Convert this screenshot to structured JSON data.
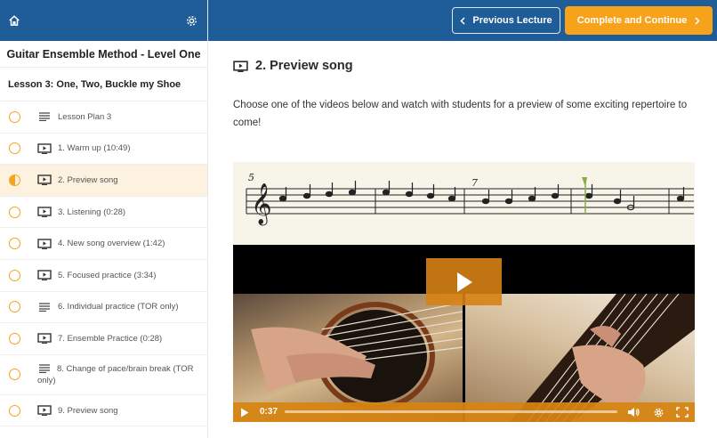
{
  "sidebar": {
    "course_title": "Guitar Ensemble Method - Level One",
    "lesson_title": "Lesson 3: One, Two, Buckle my Shoe",
    "items": [
      {
        "label": "Lesson Plan 3",
        "type": "text",
        "status": "empty"
      },
      {
        "label": "1. Warm up (10:49)",
        "type": "video",
        "status": "empty"
      },
      {
        "label": "2. Preview song",
        "type": "video",
        "status": "half"
      },
      {
        "label": "3. Listening (0:28)",
        "type": "video",
        "status": "empty"
      },
      {
        "label": "4. New song overview (1:42)",
        "type": "video",
        "status": "empty"
      },
      {
        "label": "5. Focused practice (3:34)",
        "type": "video",
        "status": "empty"
      },
      {
        "label": "6. Individual practice (TOR only)",
        "type": "text",
        "status": "empty"
      },
      {
        "label": "7. Ensemble Practice (0:28)",
        "type": "video",
        "status": "empty"
      },
      {
        "label": "8. Change of pace/brain break (TOR only)",
        "type": "text",
        "status": "empty"
      },
      {
        "label": "9. Preview song",
        "type": "video",
        "status": "empty"
      }
    ]
  },
  "topbar": {
    "prev_label": "Previous Lecture",
    "next_label": "Complete and Continue"
  },
  "main": {
    "title": "2. Preview song",
    "description": "Choose one of the videos below and watch with students for a preview of some exciting repertoire to come!"
  },
  "video": {
    "time": "0:37",
    "measure_numbers": [
      "5",
      "7"
    ]
  },
  "colors": {
    "header_blue": "#1f5d98",
    "accent_orange": "#f7a21b",
    "active_row": "#fdf1e0"
  }
}
